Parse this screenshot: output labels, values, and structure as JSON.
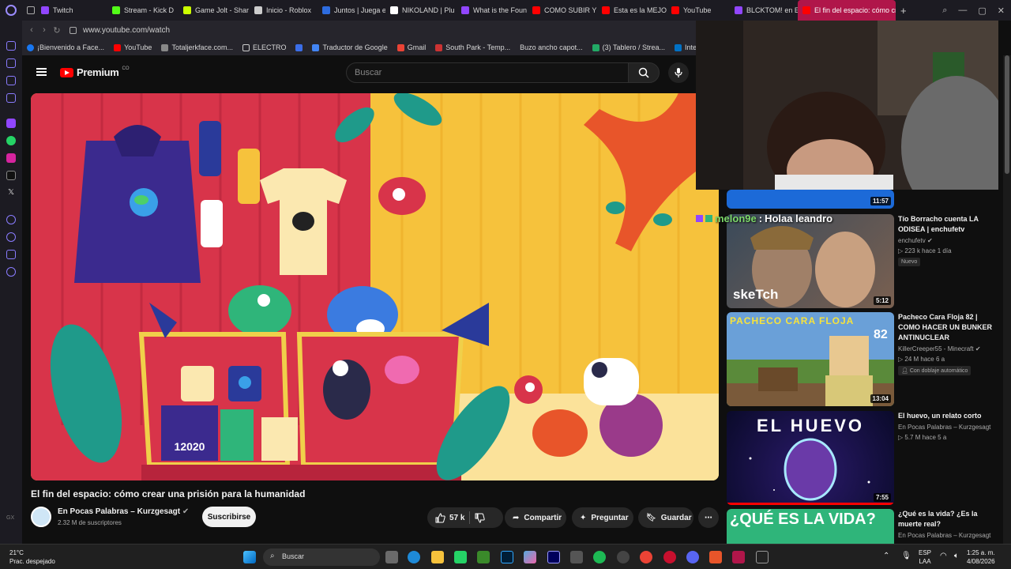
{
  "browser": {
    "tabs": [
      {
        "label": "Twitch",
        "color": "#9146ff"
      },
      {
        "label": "Stream - Kick D",
        "color": "#53fc18"
      },
      {
        "label": "Game Jolt - Shar",
        "color": "#ccff00"
      },
      {
        "label": "Inicio - Roblox",
        "color": "#cccccc"
      },
      {
        "label": "Juntos | Juega e",
        "color": "#2d6cdf"
      },
      {
        "label": "NIKOLAND | Plu",
        "color": "#ffffff"
      },
      {
        "label": "What is the Foun",
        "color": "#9146ff"
      },
      {
        "label": "COMO SUBIR Y",
        "color": "#ff0000"
      },
      {
        "label": "Esta es la MEJO",
        "color": "#ff0000"
      },
      {
        "label": "YouTube",
        "color": "#ff0000"
      },
      {
        "label": "BLCKTOM! en E",
        "color": "#9146ff"
      },
      {
        "label": "El fin del espacio: cómo cre",
        "color": "#ff0000",
        "active": true
      }
    ],
    "url": "www.youtube.com/watch",
    "bookmarks": [
      {
        "label": "¡Bienvenido a Face...",
        "color": "#1877f2"
      },
      {
        "label": "YouTube",
        "color": "#ff0000"
      },
      {
        "label": "Totaljerkface.com...",
        "color": "#888888"
      },
      {
        "label": "ELECTRO",
        "color": "#cccccc"
      },
      {
        "label": "",
        "color": "#3b6ee8"
      },
      {
        "label": "Traductor de Google",
        "color": "#4285f4"
      },
      {
        "label": "Gmail",
        "color": "#ea4335"
      },
      {
        "label": "South Park - Temp...",
        "color": "#cc3333"
      },
      {
        "label": "Buzo ancho capot...",
        "color": "#26252c"
      },
      {
        "label": "(3) Tablero / Strea...",
        "color": "#22aa66"
      },
      {
        "label": "Intel Play",
        "color": "#0071c5"
      }
    ]
  },
  "youtube": {
    "logo_text": "Premium",
    "country": "CO",
    "search_placeholder": "Buscar",
    "video": {
      "title": "El fin del espacio: cómo crear una prisión para la humanidad",
      "channel": "En Pocas Palabras – Kurzgesagt",
      "subscribers": "2.32 M de suscriptores",
      "subscribe_label": "Suscribirse",
      "likes": "57 k",
      "share_label": "Compartir",
      "ask_label": "Preguntar",
      "save_label": "Guardar",
      "thumb_scene_text": "12020"
    },
    "recommendations": [
      {
        "duration": "11:57"
      },
      {
        "title": "Tío Borracho cuenta LA ODISEA | enchufetv",
        "channel": "enchufetv",
        "meta": "▷ 223 k  hace 1 día",
        "badge": "Nuevo",
        "duration": "5:12",
        "thumb_text": "skeTch"
      },
      {
        "title": "Pacheco Cara Floja 82 | COMO HACER UN BUNKER ANTINUCLEAR",
        "channel": "KillerCreeper55 - Minecraft",
        "meta": "▷ 24 M  hace 6 a",
        "badge": "Con doblaje automático",
        "duration": "13:04",
        "thumb_text": "PACHECO CARA FLOJA",
        "thumb_num": "82"
      },
      {
        "title": "El huevo, un relato corto",
        "channel": "En Pocas Palabras – Kurzgesagt",
        "meta": "▷ 5.7 M  hace 5 a",
        "duration": "7:55",
        "thumb_text": "EL HUEVO"
      },
      {
        "title": "¿Qué es la vida? ¿Es la muerte real?",
        "channel": "En Pocas Palabras – Kurzgesagt",
        "thumb_text": "¿QUÉ ES LA VIDA?"
      }
    ]
  },
  "overlay": {
    "chat_user": "melon9e",
    "chat_msg": "Holaa leandro"
  },
  "taskbar": {
    "temp": "21°C",
    "weather": "Prac. despejado",
    "search": "Buscar",
    "lang1": "ESP",
    "lang2": "LAA",
    "time": "1:25 a. m.",
    "date": "4/08/2026"
  }
}
